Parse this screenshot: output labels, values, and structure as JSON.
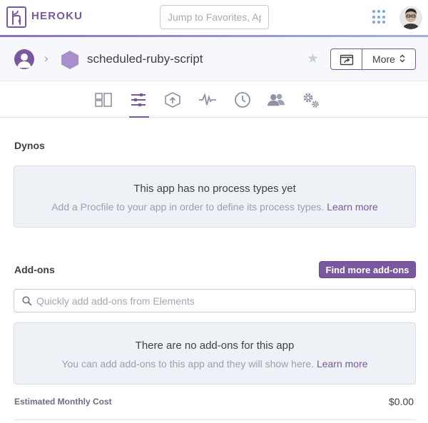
{
  "topbar": {
    "brand": "HEROKU",
    "search_placeholder": "Jump to Favorites, Ap",
    "accent_colors": [
      "#8a6fc2",
      "#9fb3de"
    ]
  },
  "app_header": {
    "app_name": "scheduled-ruby-script",
    "more_label": "More"
  },
  "tabs": [
    {
      "icon": "overview-icon",
      "active": false
    },
    {
      "icon": "resources-icon",
      "active": true
    },
    {
      "icon": "deploy-icon",
      "active": false
    },
    {
      "icon": "metrics-icon",
      "active": false
    },
    {
      "icon": "activity-icon",
      "active": false
    },
    {
      "icon": "access-icon",
      "active": false
    },
    {
      "icon": "settings-icon",
      "active": false
    }
  ],
  "dynos": {
    "title": "Dynos",
    "empty_headline": "This app has no process types yet",
    "empty_sub": "Add a Procfile to your app in order to define its process types.",
    "learn_more": "Learn more"
  },
  "addons": {
    "title": "Add-ons",
    "find_button": "Find more add-ons",
    "search_placeholder": "Quickly add add-ons from Elements",
    "empty_headline": "There are no add-ons for this app",
    "empty_sub": "You can add add-ons to this app and they will show here.",
    "learn_more": "Learn more"
  },
  "cost": {
    "label": "Estimated Monthly Cost",
    "value": "$0.00"
  },
  "colors": {
    "brand_purple": "#79589f",
    "panel_bg": "#eef1f6",
    "header_bg": "#f7f8fb"
  }
}
